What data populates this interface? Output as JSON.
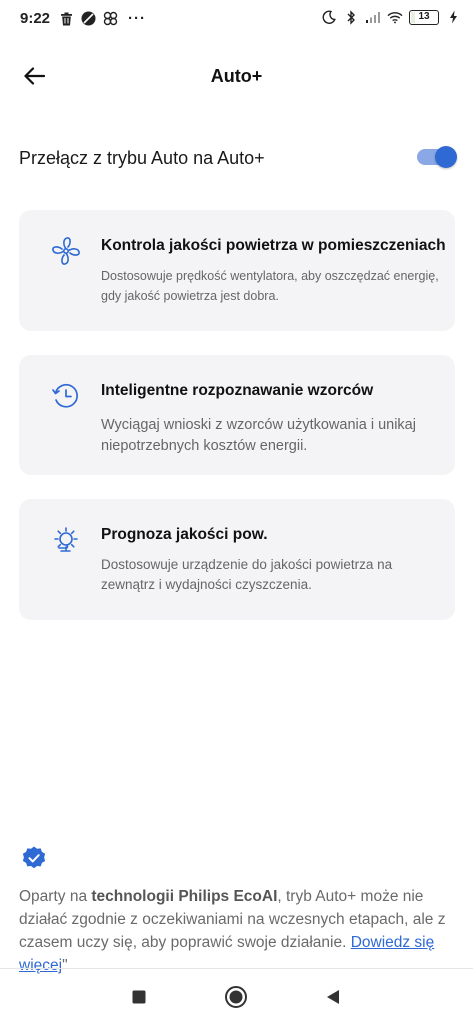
{
  "status_bar": {
    "time": "9:22",
    "more": "···",
    "battery": "13"
  },
  "header": {
    "title": "Auto+"
  },
  "toggle": {
    "label": "Przełącz z trybu Auto na Auto+",
    "state": "on"
  },
  "cards": [
    {
      "icon": "fan-icon",
      "title": "Kontrola jakości powietrza w pomieszczeniach",
      "description": "Dostosowuje prędkość wentylatora, aby oszczędzać energię, gdy jakość powietrza jest dobra."
    },
    {
      "icon": "history-clock-icon",
      "title": "Inteligentne rozpoznawanie wzorców",
      "description": "Wyciągaj wnioski z wzorców użytkowania i unikaj niepotrzebnych kosztów energii."
    },
    {
      "icon": "weather-forecast-icon",
      "title": "Prognoza jakości pow.",
      "description": "Dostosowuje urządzenie do jakości powietrza na zewnątrz i wydajności czyszczenia."
    }
  ],
  "footer": {
    "prefix": "Oparty na ",
    "bold": "technologii Philips EcoAI",
    "suffix": ", tryb Auto+ może nie działać zgodnie z oczekiwaniami na wczesnych etapach, ale z czasem uczy się, aby poprawić swoje działanie.",
    "link": "Dowiedz się więcej",
    "closing_quote": "\""
  },
  "colors": {
    "accent": "#2f69d4",
    "card_bg": "#f4f4f6",
    "secondary_text": "#666666"
  }
}
